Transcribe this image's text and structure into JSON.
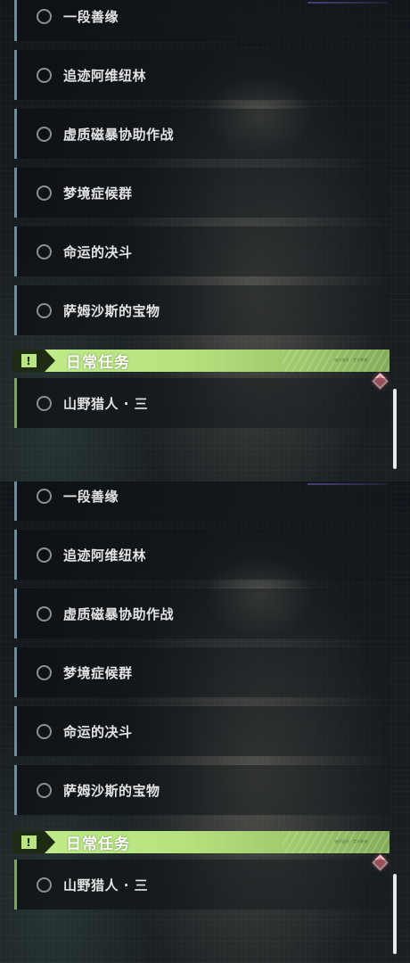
{
  "quests": [
    {
      "label": "一段善缘"
    },
    {
      "label": "追迹阿维纽林"
    },
    {
      "label": "虚质磁暴协助作战"
    },
    {
      "label": "梦境症候群"
    },
    {
      "label": "命运的决斗"
    },
    {
      "label": "萨姆沙斯的宝物"
    }
  ],
  "daily_section": {
    "title": "日常任务",
    "icon": "alert-icon",
    "icon_glyph": "!",
    "tiny_text": "每日委托 · 定时刷新",
    "quests": [
      {
        "label": "山野猎人 · 三"
      }
    ]
  },
  "colors": {
    "section_header": "#b6e27f",
    "main_quest_accent": "#6f8c98",
    "daily_quest_accent": "#7fa06a",
    "marker": "#e0707e"
  }
}
